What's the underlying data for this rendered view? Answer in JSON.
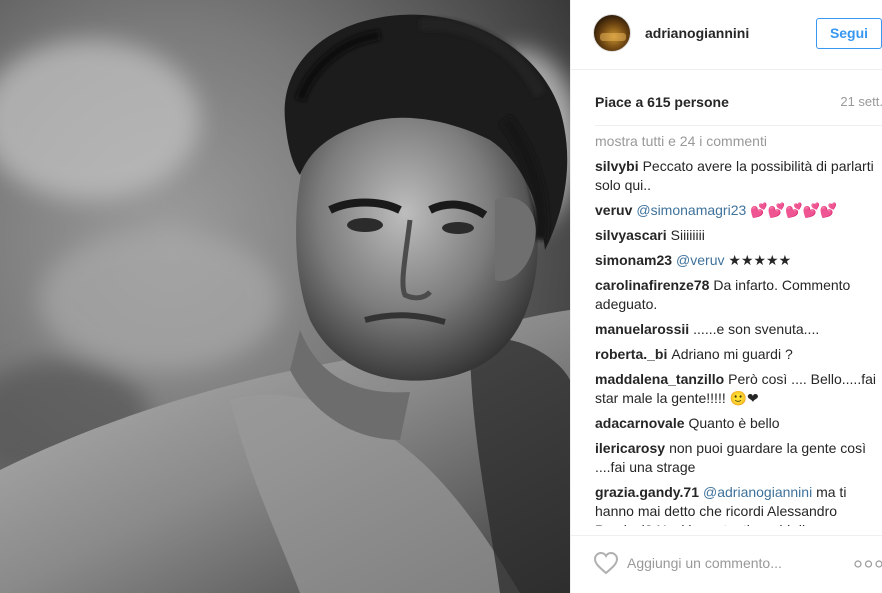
{
  "post": {
    "username": "adrianogiannini",
    "follow_label": "Segui",
    "likes": "Piace a 615 persone",
    "time": "21 sett.",
    "load_more": "mostra tutti e 24 i commenti",
    "comments": [
      {
        "user": "silvybi",
        "mention": "",
        "text": "Peccato avere la possibilità di parlarti solo qui.."
      },
      {
        "user": "veruv",
        "mention": "@simonamagri23",
        "text": "💕💕💕💕💕"
      },
      {
        "user": "silvyascari",
        "mention": "",
        "text": "Siiiiiiii"
      },
      {
        "user": "simonam23",
        "mention": "@veruv",
        "text": "★★★★★"
      },
      {
        "user": "carolinafirenze78",
        "mention": "",
        "text": "Da infarto. Commento adeguato."
      },
      {
        "user": "manuelarossii",
        "mention": "",
        "text": "......e son svenuta...."
      },
      {
        "user": "roberta._bi",
        "mention": "",
        "text": "Adriano mi guardi ?"
      },
      {
        "user": "maddalena_tanzillo",
        "mention": "",
        "text": "Però così .... Bello.....fai star male la gente!!!!! 🙂❤"
      },
      {
        "user": "adacarnovale",
        "mention": "",
        "text": "Quanto è bello"
      },
      {
        "user": "ilericarosy",
        "mention": "",
        "text": "non puoi guardare la gente così ....fai una strage"
      },
      {
        "user": "grazia.gandy.71",
        "mention": "@adrianogiannini",
        "text": "ma ti hanno mai detto che ricordi Alessandro Preziosi? Nasi importanti, occhi di"
      }
    ],
    "add_comment_placeholder": "Aggiungi un commento...",
    "icons": {
      "like": "heart-outline-icon",
      "options": "more-options-icon"
    },
    "colors": {
      "follow_blue": "#3897f0",
      "mention_blue": "#3f729b",
      "muted_gray": "#999999"
    }
  }
}
